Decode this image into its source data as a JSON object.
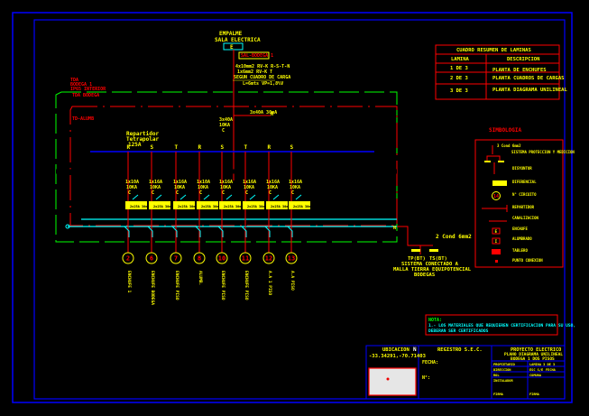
{
  "colors": {
    "background": "#000000",
    "frame": "#0000ff",
    "phase": "#ff0000",
    "text": "#ffff00",
    "bus": "#00ffff",
    "ground": "#00ff00"
  },
  "empalme": {
    "title1": "EMPALME",
    "title2": "SALA ELECTRICA",
    "box": "E",
    "feeder_tag": "SAL-BODEGA 1",
    "cable1": "4x10mm2 RV-K R-S-T-N",
    "cable2": "1x6mm2 RV-K T",
    "cable3": "SEGUN CUADRO DE CARGA",
    "cable4": "L=6mts VP=1,8%V"
  },
  "left_labels": {
    "tag1": "TDA",
    "tag2": "BODEGA 1",
    "tag3": "IP65 INTERIOR",
    "tag4": "TDA BODEGA",
    "tag5": "TD-ALUMB"
  },
  "main_breaker": {
    "label1": "3x40A",
    "label2": "10KA",
    "label3": "C",
    "diff": "3x40A 30mA",
    "neutral": "N"
  },
  "distributor": {
    "line1": "Repartidor",
    "line2": "Tetrapolar",
    "line3": "125A"
  },
  "circuits": [
    {
      "phase": "R",
      "breaker": "1x10A",
      "ka": "10KA",
      "curve": "C",
      "diff": "2x25A 30mA",
      "number": "2",
      "name": "ENCHUFE 1"
    },
    {
      "phase": "S",
      "breaker": "1x16A",
      "ka": "10KA",
      "curve": "C",
      "diff": "2x25A 30mA",
      "number": "6",
      "name": "ENCHUFE BODEGA"
    },
    {
      "phase": "T",
      "breaker": "1x16A",
      "ka": "10KA",
      "curve": "C",
      "diff": "2x25A 30mA",
      "number": "7",
      "name": "ENCHUFE PISO"
    },
    {
      "phase": "R",
      "breaker": "1x10A",
      "ka": "10KA",
      "curve": "C",
      "diff": "2x25A 30mA",
      "number": "8",
      "name": "ALUMB."
    },
    {
      "phase": "S",
      "breaker": "1x16A",
      "ka": "10KA",
      "curve": "C",
      "diff": "2x25A 30mA",
      "number": "10",
      "name": "ENCHUFE PISO"
    },
    {
      "phase": "T",
      "breaker": "1x16A",
      "ka": "10KA",
      "curve": "C",
      "diff": "2x25A 30mA",
      "number": "11",
      "name": "ENCHUFE PISO"
    },
    {
      "phase": "R",
      "breaker": "1x16A",
      "ka": "10KA",
      "curve": "C",
      "diff": "2x25A 30mA",
      "number": "12",
      "name": "A.A 1 PISO"
    },
    {
      "phase": "S",
      "breaker": "1x16A",
      "ka": "10KA",
      "curve": "C",
      "diff": "2x25A 30mA",
      "number": "13",
      "name": "A.A PISO"
    }
  ],
  "ground": {
    "cable": "2 Cond 6mm2",
    "tp1": "TP(BT)",
    "tp2": "TS(BT)",
    "line1": "SISTEMA CONECTADO A",
    "line2": "MALLA TIERRA EQUIPOTENCIAL",
    "line3": "BODEGAS"
  },
  "sheets": {
    "title": "CUADRO RESUMEN DE LAMINAS",
    "headers": [
      "LAMINA",
      "DESCRIPCION"
    ],
    "rows": [
      [
        "1 DE 3",
        "PLANTA DE ENCHUFES"
      ],
      [
        "2 DE 3",
        "PLANTA CUADROS DE CARGAS"
      ],
      [
        "3 DE 3",
        "PLANTA DIAGRAMA UNILINEAL"
      ]
    ]
  },
  "legend": {
    "title": "SIMBOLOGIA",
    "items": [
      "3 Cond 6mm2",
      "SISTEMA PROTECCION Y MEDICION",
      "DISYUNTOR",
      "DIFERENCIAL",
      "N° CIRCUITO",
      "REPARTIDOR",
      "CANALIZACION",
      "ENCHUFE",
      "ALUMBRADO",
      "TABLERO",
      "PUNTO CONEXION"
    ],
    "circuit_sample": "14",
    "enchufe_glyph": "E",
    "alumb_glyph": "I"
  },
  "note": {
    "title": "NOTA:",
    "text1": "1.- LOS MATERIALES QUE REQUIEREN CERTIFICACION PARA SU USO,",
    "text2": "DEBERAN SER CERTIFICADOS"
  },
  "title_block": {
    "location_title": "UBICACION",
    "coords": "-33.34291,-70.71403",
    "north": "N",
    "registry": "REGISTRO S.E.C.",
    "field1": "FECHA:",
    "field2": "N°:",
    "project1": "PROYECTO ELECTRICO",
    "project2": "PLANO DIAGRAMA UNILINEAL",
    "project3": "BODEGA 1 DOS PISOS",
    "r1a": "PROPIETARIO",
    "r1b": "LAMINA 3 DE 3",
    "r2a": "DIRECCION",
    "r2b": "ESC S/E",
    "r2c": "FECHA",
    "r3a": "ROL",
    "r3b": "COMUNA",
    "r4a": "INSTALADOR",
    "r5a": "FIRMA",
    "r5b": "FIRMA"
  }
}
